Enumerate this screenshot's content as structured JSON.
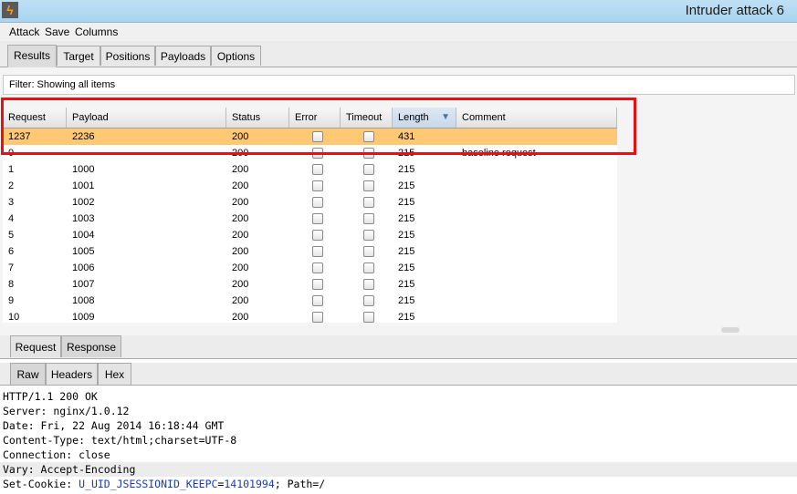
{
  "window": {
    "title": "Intruder attack 6"
  },
  "menu": [
    "Attack",
    "Save",
    "Columns"
  ],
  "tabs": [
    "Results",
    "Target",
    "Positions",
    "Payloads",
    "Options"
  ],
  "filter_text": "Filter:  Showing all items",
  "table": {
    "columns": [
      "Request",
      "Payload",
      "Status",
      "Error",
      "Timeout",
      "Length",
      "Comment"
    ],
    "rows": [
      {
        "request": "1237",
        "payload": "2236",
        "status": "200",
        "length": "431",
        "comment": ""
      },
      {
        "request": "0",
        "payload": "",
        "status": "200",
        "length": "215",
        "comment": "baseline request"
      },
      {
        "request": "1",
        "payload": "1000",
        "status": "200",
        "length": "215",
        "comment": ""
      },
      {
        "request": "2",
        "payload": "1001",
        "status": "200",
        "length": "215",
        "comment": ""
      },
      {
        "request": "3",
        "payload": "1002",
        "status": "200",
        "length": "215",
        "comment": ""
      },
      {
        "request": "4",
        "payload": "1003",
        "status": "200",
        "length": "215",
        "comment": ""
      },
      {
        "request": "5",
        "payload": "1004",
        "status": "200",
        "length": "215",
        "comment": ""
      },
      {
        "request": "6",
        "payload": "1005",
        "status": "200",
        "length": "215",
        "comment": ""
      },
      {
        "request": "7",
        "payload": "1006",
        "status": "200",
        "length": "215",
        "comment": ""
      },
      {
        "request": "8",
        "payload": "1007",
        "status": "200",
        "length": "215",
        "comment": ""
      },
      {
        "request": "9",
        "payload": "1008",
        "status": "200",
        "length": "215",
        "comment": ""
      },
      {
        "request": "10",
        "payload": "1009",
        "status": "200",
        "length": "215",
        "comment": ""
      }
    ]
  },
  "req_resp_tabs": [
    "Request",
    "Response"
  ],
  "view_tabs": [
    "Raw",
    "Headers",
    "Hex"
  ],
  "response": {
    "lines": [
      "HTTP/1.1 200 OK",
      "Server: nginx/1.0.12",
      "Date: Fri, 22 Aug 2014 16:18:44 GMT",
      "Content-Type: text/html;charset=UTF-8",
      "Connection: close",
      "Vary: Accept-Encoding"
    ],
    "cookie_prefix": "Set-Cookie: ",
    "cookie_name": "U_UID_JSESSIONID_KEEPC",
    "cookie_eq": "=",
    "cookie_value": "14101994",
    "cookie_suffix": "; Path=/"
  }
}
